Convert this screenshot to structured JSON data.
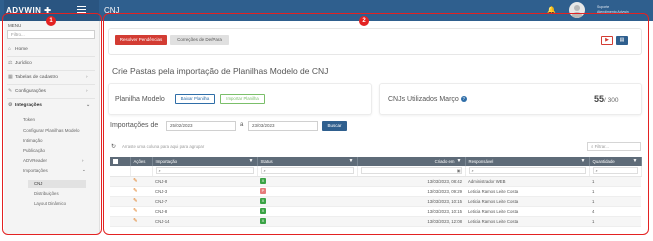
{
  "app": {
    "brand": "ADVWIN",
    "page_title": "CNJ"
  },
  "user": {
    "line1": "Suporte",
    "line2": "Atendimento Advwin"
  },
  "callouts": [
    "1",
    "2"
  ],
  "colors": {
    "topbar": "#2f5f8e",
    "callout": "#e32222",
    "accent_red": "#d33c33",
    "header_gray": "#5e6b78"
  },
  "sidebar": {
    "menu_label": "MENU",
    "filter_placeholder": "Filtro...",
    "items": [
      {
        "label": "Home",
        "icon": "home-icon"
      },
      {
        "label": "Jurídico",
        "icon": "gavel-icon"
      },
      {
        "label": "Tabelas de cadastro",
        "icon": "table-icon"
      },
      {
        "label": "Configurações",
        "icon": "wrench-icon"
      },
      {
        "label": "Integrações",
        "icon": "sliders-icon"
      }
    ],
    "sub_items": [
      "Token",
      "Configurar Planilhas Modelo",
      "Intimação",
      "Publicação",
      "ADVReader",
      "Importações"
    ],
    "importacoes_items": [
      "CNJ",
      "Distribuições",
      "Layout Dinâmico"
    ]
  },
  "actions": {
    "resolve_label": "Resolver Pendências",
    "corrections_label": "Correções de De/Para",
    "video_icon": "youtube-icon",
    "info_icon": "id-card-icon"
  },
  "main": {
    "title": "Crie Pastas pela importação de Planilhas Modelo de CNJ",
    "planilha_label": "Planilha Modelo",
    "baixar_label": "Baixar Planilha",
    "importar_label": "Importar Planilha",
    "cnj_label": "CNJs Utilizados Março",
    "cnj_used": "55",
    "cnj_total": "/ 300",
    "importacoes_label": "Importações de",
    "date_from": "25/02/2023",
    "a_label": "a",
    "date_to": "23/03/2023",
    "buscar_label": "Buscar",
    "group_hint": "Arraste uma coluna para aqui para agrupar",
    "filter_placeholder": "Filtrar..."
  },
  "table": {
    "headers": [
      "Ações",
      "Importação",
      "Status",
      "Criado em",
      "Responsável",
      "Quantidade"
    ],
    "rows": [
      {
        "importacao": "CNJ-8",
        "status": "excel",
        "criado": "13/03/2023, 08:42",
        "responsavel": "Administrador WEB",
        "quantidade": "1"
      },
      {
        "importacao": "CNJ-3",
        "status": "pdf",
        "criado": "13/03/2023, 09:29",
        "responsavel": "Leticia Ramos Leite Costa",
        "quantidade": "1"
      },
      {
        "importacao": "CNJ-7",
        "status": "excel",
        "criado": "13/03/2023, 10:15",
        "responsavel": "Leticia Ramos Leite Costa",
        "quantidade": "1"
      },
      {
        "importacao": "CNJ-8",
        "status": "excel",
        "criado": "13/03/2023, 10:15",
        "responsavel": "Leticia Ramos Leite Costa",
        "quantidade": "4"
      },
      {
        "importacao": "CNJ-14",
        "status": "excel",
        "criado": "13/03/2023, 12:08",
        "responsavel": "Leticia Ramos Leite Costa",
        "quantidade": "1"
      }
    ]
  }
}
